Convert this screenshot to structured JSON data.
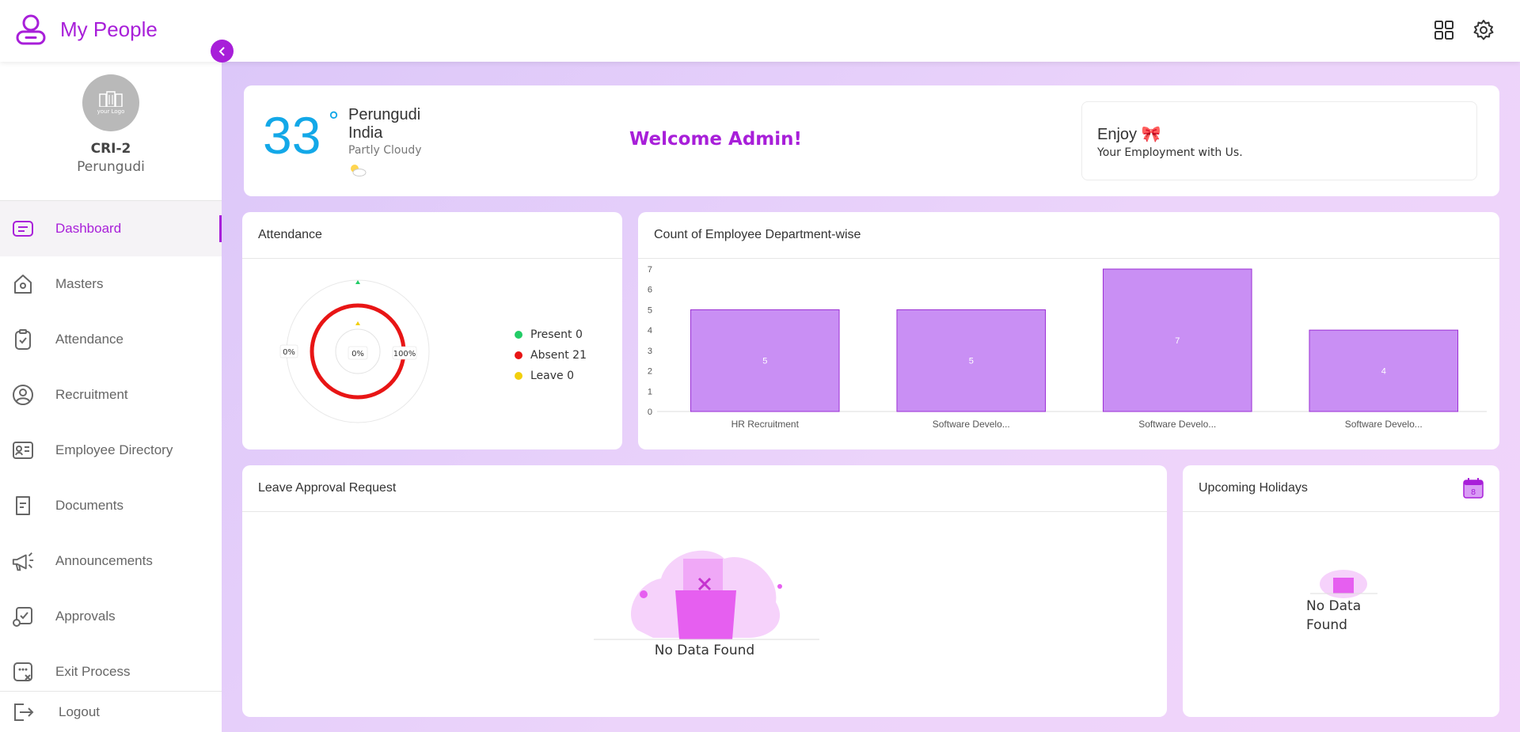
{
  "app": {
    "title": "My People"
  },
  "header": {
    "apps_icon": "grid-icon",
    "settings_icon": "gear-icon"
  },
  "sidebar": {
    "logo_text": "your Logo",
    "org_name": "CRI-2",
    "org_location": "Perungudi",
    "items": [
      {
        "label": "Dashboard",
        "icon": "dashboard-icon",
        "active": true
      },
      {
        "label": "Masters",
        "icon": "home-icon"
      },
      {
        "label": "Attendance",
        "icon": "clipboard-icon"
      },
      {
        "label": "Recruitment",
        "icon": "user-circle-icon"
      },
      {
        "label": "Employee Directory",
        "icon": "id-card-icon"
      },
      {
        "label": "Documents",
        "icon": "document-icon"
      },
      {
        "label": "Announcements",
        "icon": "megaphone-icon"
      },
      {
        "label": "Approvals",
        "icon": "approval-icon"
      },
      {
        "label": "Exit Process",
        "icon": "exit-icon"
      }
    ],
    "logout_label": "Logout"
  },
  "weather": {
    "temperature": "33",
    "degree_symbol": "°",
    "city": "Perungudi",
    "country": "India",
    "condition": "Partly Cloudy"
  },
  "welcome": {
    "message": "Welcome Admin!"
  },
  "enjoy": {
    "title": "Enjoy 🎀",
    "subtitle": "Your Employment with Us."
  },
  "attendance": {
    "title": "Attendance",
    "gauge_labels": {
      "left": "0%",
      "center": "0%",
      "right": "100%"
    },
    "legend": [
      {
        "label": "Present 0",
        "color": "#22cc66"
      },
      {
        "label": "Absent 21",
        "color": "#e81515"
      },
      {
        "label": "Leave 0",
        "color": "#f2cf0c"
      }
    ]
  },
  "dept_chart": {
    "title": "Count of Employee Department-wise"
  },
  "chart_data": {
    "type": "bar",
    "categories": [
      "HR Recruitment",
      "Software Develo...",
      "Software Develo...",
      "Software Develo..."
    ],
    "values": [
      5,
      5,
      7,
      4
    ],
    "ylim": [
      0,
      7
    ],
    "yticks": [
      0,
      1,
      2,
      3,
      4,
      5,
      6,
      7
    ],
    "bar_color": "#c98ff4",
    "bar_border": "#9b2fd4",
    "grid": false
  },
  "leave_request": {
    "title": "Leave Approval Request",
    "empty_text": "No Data Found"
  },
  "holidays": {
    "title": "Upcoming Holidays",
    "calendar_day": "8",
    "empty_text": "No Data\nFound"
  },
  "colors": {
    "accent": "#a81fd9",
    "temperature": "#13a8e8"
  }
}
